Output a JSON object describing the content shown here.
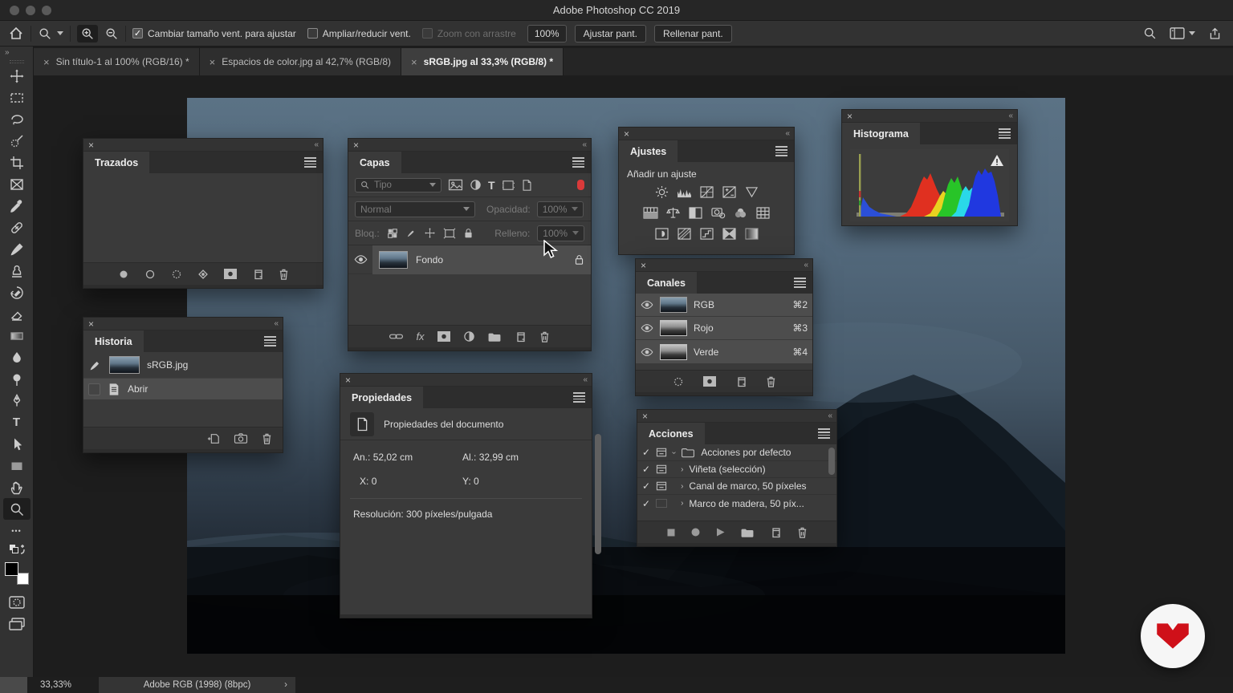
{
  "window": {
    "title": "Adobe Photoshop CC 2019"
  },
  "glyphs": {
    "close": "×",
    "collapse": "«",
    "double_chevron": "»",
    "check": "✓",
    "expand": "›",
    "ellipsis": "•••",
    "chevron": "›",
    "fx": "fx",
    "type": "T"
  },
  "options_bar": {
    "resize_windows_label": "Cambiar tamaño vent. para ajustar",
    "zoom_all_windows_label": "Ampliar/reducir vent.",
    "scrubby_zoom_label": "Zoom con arrastre",
    "zoom_value": "100%",
    "fit_screen_label": "Ajustar pant.",
    "fill_screen_label": "Rellenar pant."
  },
  "tabs": [
    {
      "label": "Sin título-1 al 100% (RGB/16) *",
      "active": false
    },
    {
      "label": "Espacios de color.jpg al 42,7% (RGB/8)",
      "active": false
    },
    {
      "label": "sRGB.jpg al 33,3% (RGB/8) *",
      "active": true
    }
  ],
  "panels": {
    "trazados": {
      "title": "Trazados"
    },
    "capas": {
      "title": "Capas",
      "filter_placeholder": "Tipo",
      "blend_mode": "Normal",
      "opacity_label": "Opacidad:",
      "opacity_value": "100%",
      "lock_label": "Bloq.:",
      "fill_label": "Relleno:",
      "fill_value": "100%",
      "layers": [
        {
          "name": "Fondo"
        }
      ]
    },
    "ajustes": {
      "title": "Ajustes",
      "subtitle": "Añadir un ajuste"
    },
    "histograma": {
      "title": "Histograma",
      "chart": {
        "type": "histogram",
        "note": "RGB colors histogram, left clipping spike, warning badge shown",
        "regions": [
          {
            "color": "#9aa050",
            "x_pct": [
              4,
              5
            ],
            "peak_pct": 95
          },
          {
            "color": "#2b4fd8",
            "x_pct": [
              5,
              22
            ],
            "peak_pct": 22
          },
          {
            "color": "#e03020",
            "x_pct": [
              36,
              60
            ],
            "peak_pct": 62
          },
          {
            "color": "#e8d220",
            "x_pct": [
              50,
              66
            ],
            "peak_pct": 45
          },
          {
            "color": "#28c428",
            "x_pct": [
              58,
              72
            ],
            "peak_pct": 70
          },
          {
            "color": "#2ad8e8",
            "x_pct": [
              66,
              80
            ],
            "peak_pct": 52
          },
          {
            "color": "#2038e0",
            "x_pct": [
              74,
              92
            ],
            "peak_pct": 78
          }
        ]
      }
    },
    "canales": {
      "title": "Canales",
      "channels": [
        {
          "name": "RGB",
          "shortcut": "⌘2"
        },
        {
          "name": "Rojo",
          "shortcut": "⌘3"
        },
        {
          "name": "Verde",
          "shortcut": "⌘4"
        }
      ]
    },
    "historia": {
      "title": "Historia",
      "items": [
        {
          "label": "sRGB.jpg"
        },
        {
          "label": "Abrir"
        }
      ]
    },
    "propiedades": {
      "title": "Propiedades",
      "header": "Propiedades del documento",
      "width_label": "An.:",
      "width_value": "52,02 cm",
      "height_label": "Al.:",
      "height_value": "32,99 cm",
      "x_label": "X:",
      "x_value": "0",
      "y_label": "Y:",
      "y_value": "0",
      "resolution": "Resolución: 300 píxeles/pulgada"
    },
    "acciones": {
      "title": "Acciones",
      "items": [
        {
          "label": "Acciones por defecto"
        },
        {
          "label": "Viñeta (selección)"
        },
        {
          "label": "Canal de marco, 50 píxeles"
        },
        {
          "label": "Marco de madera, 50 píx..."
        }
      ]
    }
  },
  "statusbar": {
    "zoom": "33,33%",
    "profile": "Adobe RGB (1998) (8bpc)"
  }
}
